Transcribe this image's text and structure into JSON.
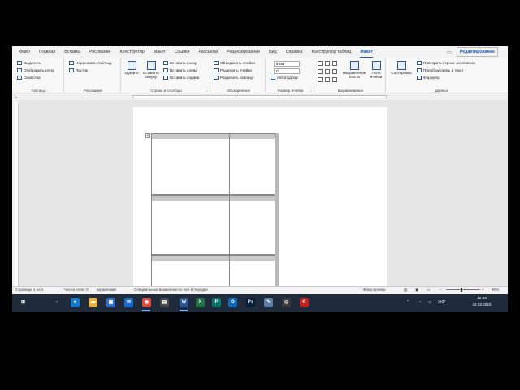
{
  "ribbon_tabs": [
    "Файл",
    "Главная",
    "Вставка",
    "Рисование",
    "Конструктор",
    "Макет",
    "Ссылки",
    "Рассылки",
    "Рецензирование",
    "Вид",
    "Справка",
    "Конструктор таблиц",
    "Макет"
  ],
  "active_tab_index": 12,
  "editing_mode": "Редактирование",
  "groups": {
    "table": {
      "name": "Таблица",
      "select": "Выделить",
      "gridlines": "Отобразить сетку",
      "properties": "Свойства"
    },
    "draw": {
      "name": "Рисование",
      "draw_table": "Нарисовать таблицу",
      "eraser": "Ластик"
    },
    "rows_cols": {
      "name": "Строки и столбцы",
      "delete": "Удалить",
      "insert_above": "Вставить сверху",
      "insert_below": "Вставить снизу",
      "insert_left": "Вставить слева",
      "insert_right": "Вставить справа"
    },
    "merge": {
      "name": "Объединение",
      "merge_cells": "Объединить ячейки",
      "split_cells": "Разделить ячейки",
      "split_table": "Разделить таблицу"
    },
    "cell_size": {
      "name": "Размер ячейки",
      "height": "5 см",
      "width": "0",
      "autofit": "Автоподбор"
    },
    "alignment": {
      "name": "Выравнивание",
      "text_direction": "Направление текста",
      "cell_margins": "Поля ячейки"
    },
    "data": {
      "name": "Данные",
      "sort": "Сортировка",
      "repeat_header": "Повторить строки заголовков",
      "convert": "Преобразовать в текст",
      "formula": "Формула"
    }
  },
  "status": {
    "page": "Страница 1 из 1",
    "words": "Число слов: 0",
    "lang": "украинский",
    "accessibility": "Специальные возможности: все в порядке",
    "focus": "Фокусировка",
    "zoom": "90%"
  },
  "taskbar": {
    "time": "12:59",
    "date": "22.02.2023",
    "lang": "УКР",
    "apps": [
      {
        "name": "windows-start-icon",
        "color": "#1f2a3a",
        "glyph": "⊞"
      },
      {
        "name": "search-icon",
        "color": "#1f2a3a",
        "glyph": "○"
      },
      {
        "name": "edge-icon",
        "color": "#0f7bd1",
        "glyph": "e"
      },
      {
        "name": "explorer-icon",
        "color": "#e8b33a",
        "glyph": "▬"
      },
      {
        "name": "store-icon",
        "color": "#2f6fd1",
        "glyph": "▦"
      },
      {
        "name": "mail-icon",
        "color": "#1770d4",
        "glyph": "✉"
      },
      {
        "name": "chrome-icon",
        "color": "#e04a3a",
        "glyph": "◉"
      },
      {
        "name": "calculator-icon",
        "color": "#4a4a4a",
        "glyph": "▤"
      },
      {
        "name": "word-icon",
        "color": "#2b579a",
        "glyph": "W"
      },
      {
        "name": "excel-icon",
        "color": "#217346",
        "glyph": "X"
      },
      {
        "name": "publisher-icon",
        "color": "#077568",
        "glyph": "P"
      },
      {
        "name": "outlook-icon",
        "color": "#0f6cbd",
        "glyph": "O"
      },
      {
        "name": "photoshop-icon",
        "color": "#001e36",
        "glyph": "Ps"
      },
      {
        "name": "paint-icon",
        "color": "#5b7fa6",
        "glyph": "✎"
      },
      {
        "name": "camera-icon",
        "color": "#3a3a3a",
        "glyph": "◎"
      },
      {
        "name": "recorder-icon",
        "color": "#c41e1e",
        "glyph": "C"
      }
    ]
  }
}
